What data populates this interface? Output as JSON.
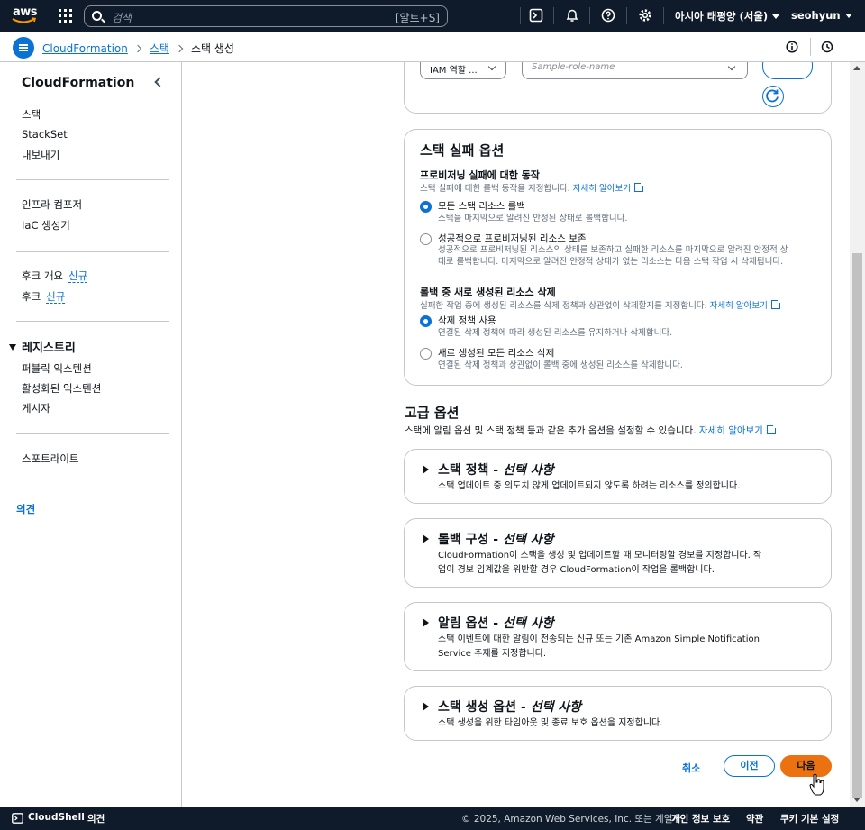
{
  "topnav": {
    "logo": "aws",
    "search_placeholder": "검색",
    "search_shortcut": "[알트+S]",
    "region": "아시아 태평양 (서울)",
    "user": "seohyun",
    "icons": [
      "cloudshell-icon",
      "bell-icon",
      "help-icon",
      "gear-icon"
    ]
  },
  "breadcrumb": {
    "items": [
      "CloudFormation",
      "스택",
      "스택 생성"
    ]
  },
  "sidebar": {
    "title": "CloudFormation",
    "group1": [
      "스택",
      "StackSet",
      "내보내기"
    ],
    "group2": [
      "인프라 컴포저",
      "IaC 생성기"
    ],
    "hooks_overview": "후크 개요",
    "hooks": "후크",
    "new_badge": "신규",
    "registry_title": "레지스트리",
    "registry": [
      "퍼블릭 익스텐션",
      "활성화된 익스텐션",
      "게시자"
    ],
    "spotlight": "스포트라이트",
    "feedback": "의견"
  },
  "top_card": {
    "iam_select": "IAM 역할 ...",
    "role_placeholder": "Sample-role-name"
  },
  "failure_options": {
    "title": "스택 실패 옵션",
    "behavior_label": "프로비저닝 실패에 대한 동작",
    "behavior_desc": "스택 실패에 대한 롤백 동작을 지정합니다.",
    "learn_more": "자세히 알아보기",
    "opt1_label": "모든 스택 리소스 롤백",
    "opt1_desc": "스택을 마지막으로 알려진 안정된 상태로 롤백합니다.",
    "opt2_label": "성공적으로 프로비저닝된 리소스 보존",
    "opt2_desc_line1": "성공적으로 프로비저닝된 리소스의 상태를 보존하고 실패한 리소스를 마지막으로 알려진 안정적 상",
    "opt2_desc_line2": "태로 롤백합니다. 마지막으로 알려진 안정적 상태가 없는 리소스는 다음 스택 작업 시 삭제됩니다.",
    "delete_label": "롤백 중 새로 생성된 리소스 삭제",
    "delete_desc": "실패한 작업 중에 생성된 리소스를 삭제 정책과 상관없이 삭제할지를 지정합니다.",
    "opt3_label": "삭제 정책 사용",
    "opt3_desc": "연결된 삭제 정책에 따라 생성된 리소스를 유지하거나 삭제합니다.",
    "opt4_label": "새로 생성된 모든 리소스 삭제",
    "opt4_desc": "연결된 삭제 정책과 상관없이 롤백 중에 생성된 리소스를 삭제합니다.",
    "selected_behavior": "모든 스택 리소스 롤백",
    "selected_delete": "삭제 정책 사용"
  },
  "advanced": {
    "title": "고급 옵션",
    "desc": "스택에 알림 옵션 및 스택 정책 등과 같은 추가 옵션을 설정할 수 있습니다.",
    "learn_more": "자세히 알아보기",
    "optional": "선택 사항",
    "sections": [
      {
        "title": "스택 정책 - ",
        "desc1": "스택 업데이트 중 의도치 않게 업데이트되지 않도록 하려는 리소스를 정의합니다.",
        "desc2": ""
      },
      {
        "title": "롤백 구성 - ",
        "desc1": "CloudFormation이 스택을 생성 및 업데이트할 때 모니터링할 경보를 지정합니다. 작",
        "desc2": "업이 경보 임계값을 위반할 경우 CloudFormation이 작업을 롤백합니다."
      },
      {
        "title": "알림 옵션 - ",
        "desc1": "스택 이벤트에 대한 알림이 전송되는 신규 또는 기존 Amazon Simple Notification",
        "desc2": "Service 주제를 지정합니다."
      },
      {
        "title": "스택 생성 옵션 - ",
        "desc1": "스택 생성을 위한 타임아웃 및 종료 보호 옵션을 지정합니다.",
        "desc2": ""
      }
    ]
  },
  "actions": {
    "cancel": "취소",
    "previous": "이전",
    "next": "다음"
  },
  "footer": {
    "cloudshell": "CloudShell",
    "feedback": "의견",
    "copyright": "© 2025, Amazon Web Services, Inc. 또는 계열사.",
    "privacy": "개인 정보 보호",
    "terms": "약관",
    "cookies": "쿠키 기본 설정"
  },
  "colors": {
    "nav_bg": "#0f1b2a",
    "link": "#0972d3",
    "primary_button": "#ec7211",
    "border": "#c6c6cd"
  }
}
